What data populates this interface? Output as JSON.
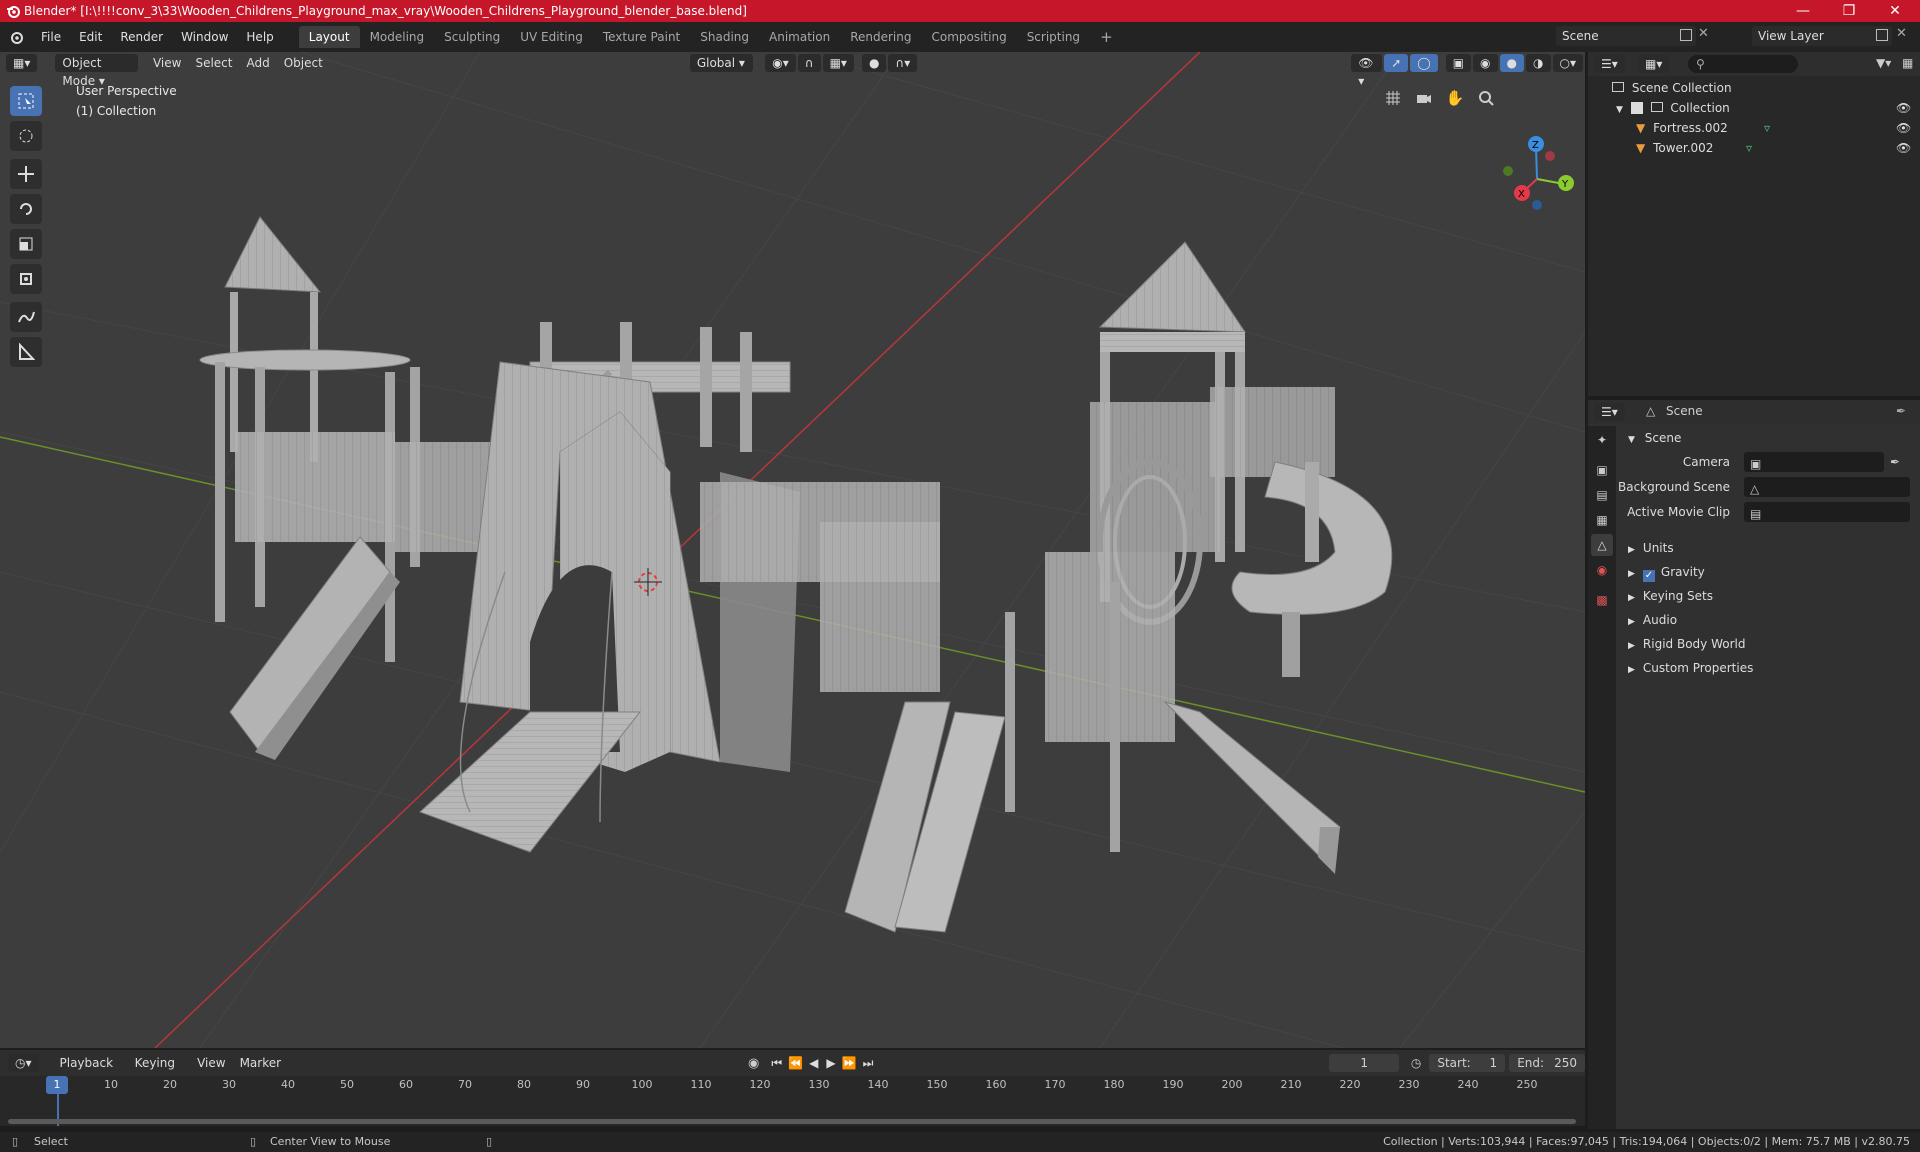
{
  "window": {
    "title": "Blender* [I:\\!!!!conv_3\\33\\Wooden_Childrens_Playground_max_vray\\Wooden_Childrens_Playground_blender_base.blend]"
  },
  "menus": [
    "File",
    "Edit",
    "Render",
    "Window",
    "Help"
  ],
  "workspaces": [
    "Layout",
    "Modeling",
    "Sculpting",
    "UV Editing",
    "Texture Paint",
    "Shading",
    "Animation",
    "Rendering",
    "Compositing",
    "Scripting"
  ],
  "scene": "Scene",
  "view_layer": "View Layer",
  "viewport": {
    "mode": "Object Mode",
    "menus": [
      "View",
      "Select",
      "Add",
      "Object"
    ],
    "transform": "Global",
    "label_perspective": "User Perspective",
    "label_collection": "(1) Collection",
    "gizmo": {
      "x": "X",
      "y": "Y",
      "z": "Z"
    }
  },
  "outliner": {
    "root": "Scene Collection",
    "collection": "Collection",
    "objects": [
      "Fortress.002",
      "Tower.002"
    ]
  },
  "properties": {
    "header": "Scene",
    "section": "Scene",
    "fields": [
      {
        "label": "Camera",
        "value": ""
      },
      {
        "label": "Background Scene",
        "value": ""
      },
      {
        "label": "Active Movie Clip",
        "value": ""
      }
    ],
    "panels": [
      "Units",
      "Gravity",
      "Keying Sets",
      "Audio",
      "Rigid Body World",
      "Custom Properties"
    ],
    "gravity_checked": true
  },
  "timeline": {
    "menus": [
      "Playback",
      "Keying",
      "View",
      "Marker"
    ],
    "current_frame": "1",
    "start_label": "Start:",
    "start": "1",
    "end_label": "End:",
    "end": "250",
    "ticks": [
      "10",
      "20",
      "30",
      "40",
      "50",
      "60",
      "70",
      "80",
      "90",
      "100",
      "110",
      "120",
      "130",
      "140",
      "150",
      "160",
      "170",
      "180",
      "190",
      "200",
      "210",
      "220",
      "230",
      "240",
      "250"
    ],
    "playhead": "1"
  },
  "status": {
    "select": "Select",
    "center": "Center View to Mouse",
    "stats": "Collection | Verts:103,944 | Faces:97,045 | Tris:194,064 | Objects:0/2 | Mem: 75.7 MB | v2.80.75"
  },
  "colors": {
    "title_bar": "#c5162a",
    "accent": "#4772b3",
    "x_axis": "#e5394b",
    "y_axis": "#8bcb2f",
    "z_axis": "#3b8de0"
  }
}
